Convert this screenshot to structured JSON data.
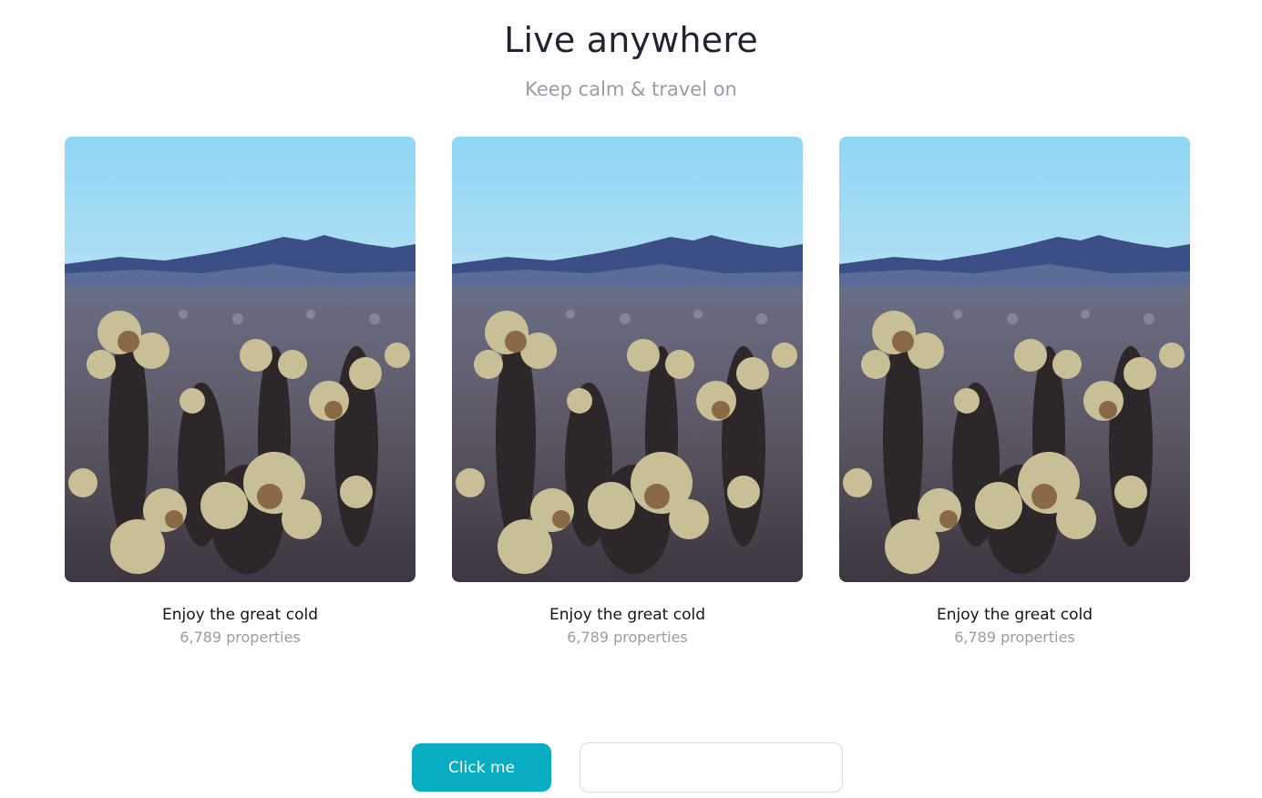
{
  "header": {
    "title": "Live anywhere",
    "subtitle": "Keep calm & travel on"
  },
  "cards": [
    {
      "title": "Enjoy the great cold",
      "meta": "6,789 properties",
      "image": "desert-cactus-landscape-photo"
    },
    {
      "title": "Enjoy the great cold",
      "meta": "6,789 properties",
      "image": "desert-cactus-landscape-photo"
    },
    {
      "title": "Enjoy the great cold",
      "meta": "6,789 properties",
      "image": "desert-cactus-landscape-photo"
    }
  ],
  "actions": {
    "button_label": "Click me",
    "input_value": "",
    "input_placeholder": ""
  },
  "colors": {
    "title": "#1f2530",
    "muted": "#9a9ba6",
    "accent": "#08adc2",
    "input_border": "#d9dbe0"
  }
}
